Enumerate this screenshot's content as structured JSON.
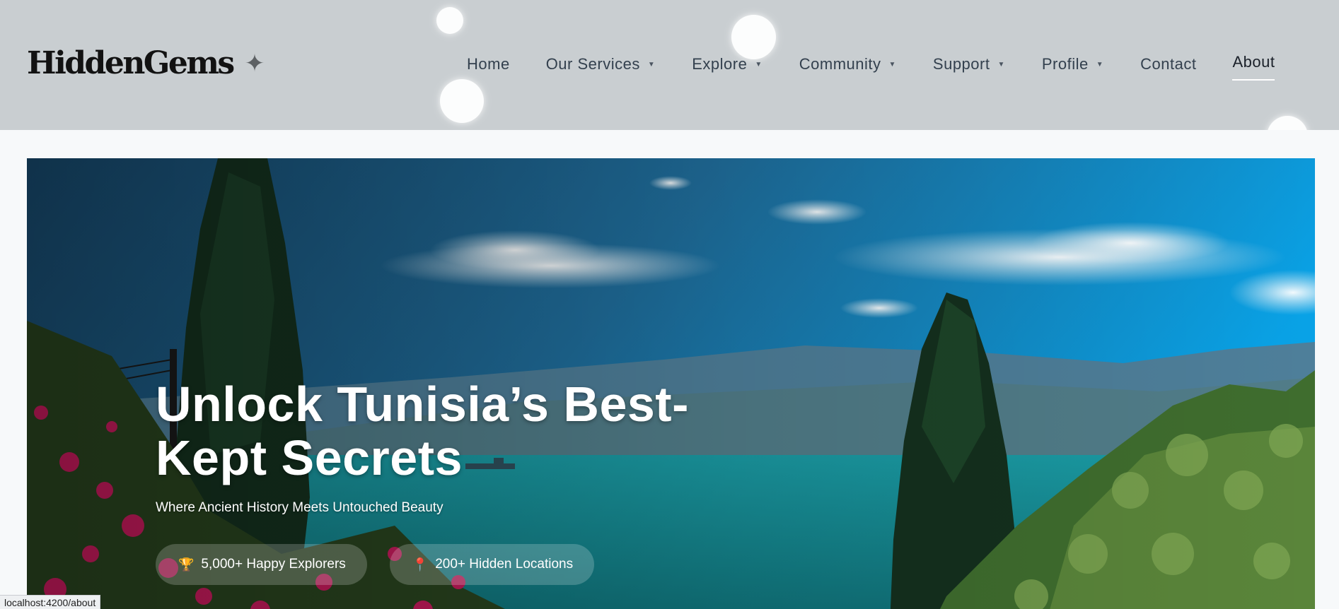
{
  "brand": {
    "name": "HiddenGems",
    "icon": "sparkle-icon"
  },
  "nav": {
    "items": [
      {
        "label": "Home",
        "dropdown": false
      },
      {
        "label": "Our Services",
        "dropdown": true
      },
      {
        "label": "Explore",
        "dropdown": true
      },
      {
        "label": "Community",
        "dropdown": true
      },
      {
        "label": "Support",
        "dropdown": true
      },
      {
        "label": "Profile",
        "dropdown": true
      },
      {
        "label": "Contact",
        "dropdown": false
      },
      {
        "label": "About",
        "dropdown": false,
        "active": true
      }
    ],
    "caret": "▼"
  },
  "hero": {
    "title": "Unlock Tunisia’s Best-Kept Secrets",
    "subtitle": "Where Ancient History Meets Untouched Beauty",
    "stats": [
      {
        "icon": "trophy-icon",
        "label": "5,000+ Happy Explorers"
      },
      {
        "icon": "pin-icon",
        "label": "200+ Hidden Locations"
      }
    ],
    "image": "coastal landscape with cypress trees, flowering bougainvillea and mountains across a turquoise bay"
  },
  "status_bar": {
    "url": "localhost:4200/about"
  },
  "colors": {
    "header_bg": "#c9ced1",
    "nav_text": "#33404e",
    "page_bg": "#f7f9fa",
    "active_underline": "#ffffff"
  }
}
